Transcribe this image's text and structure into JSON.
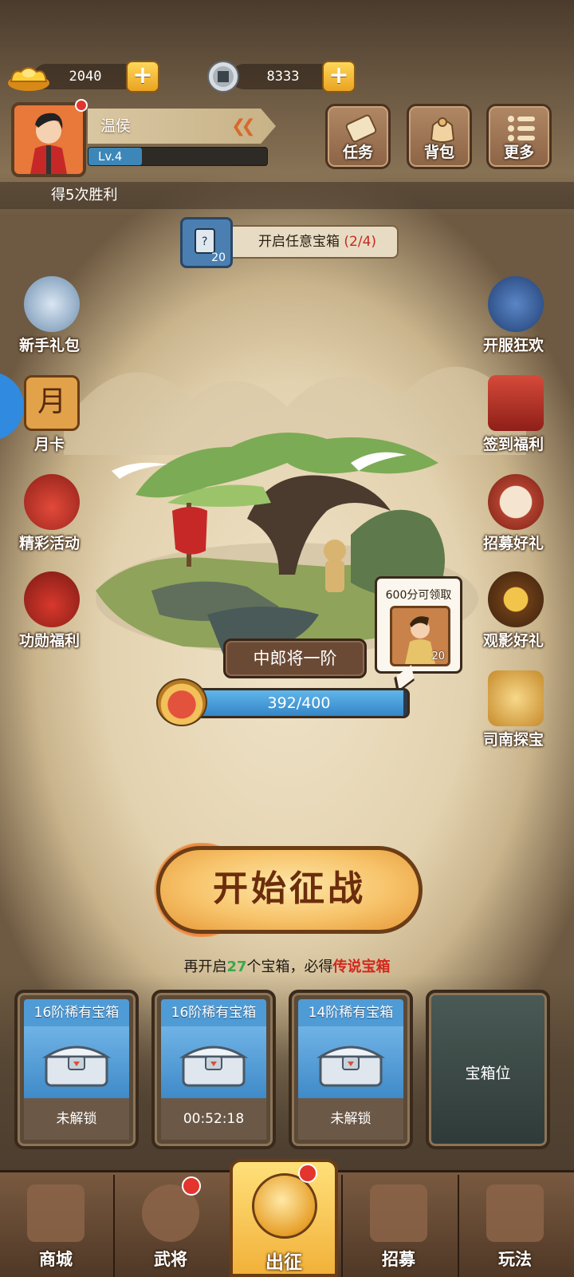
{
  "currency": {
    "gold": {
      "icon": "gold-ingot-icon",
      "value": "2040"
    },
    "silver": {
      "icon": "coin-icon",
      "value": "8333"
    }
  },
  "player": {
    "name": "温侯",
    "level": "Lv.4"
  },
  "top_buttons": [
    {
      "id": "task",
      "label": "任务",
      "icon": "scroll-icon"
    },
    {
      "id": "bag",
      "label": "背包",
      "icon": "bag-icon"
    },
    {
      "id": "more",
      "label": "更多",
      "icon": "menu-icon"
    }
  ],
  "quest_strip": "得5次胜利",
  "chest_task": {
    "text": "开启任意宝箱",
    "progress": "(2/4)",
    "reward_count": "20"
  },
  "left_side": [
    {
      "label": "新手礼包",
      "icon": "warrior-icon"
    },
    {
      "label": "月卡",
      "icon": "month-card-icon",
      "glyph": "月"
    },
    {
      "label": "精彩活动",
      "icon": "gift-bag-icon"
    },
    {
      "label": "功勋福利",
      "icon": "treasure-bag-icon"
    }
  ],
  "right_side": [
    {
      "label": "开服狂欢",
      "icon": "official-icon"
    },
    {
      "label": "签到福利",
      "icon": "seal-icon"
    },
    {
      "label": "招募好礼",
      "icon": "drum-icon"
    },
    {
      "label": "观影好礼",
      "icon": "video-reward-icon"
    },
    {
      "label": "司南探宝",
      "icon": "compass-icon"
    }
  ],
  "stage": {
    "rank": "中郎将一阶",
    "exp_text": "392/400",
    "exp_progress": 0.98,
    "reward_hint": "600分可领取",
    "reward_count": "20"
  },
  "start_button": "开始征战",
  "chest_hint": {
    "prefix": "再开启",
    "count": "27",
    "middle": "个宝箱，必得",
    "highlight": "传说宝箱"
  },
  "chest_slots": [
    {
      "title": "16阶稀有宝箱",
      "status": "未解锁"
    },
    {
      "title": "16阶稀有宝箱",
      "status": "00:52:18"
    },
    {
      "title": "14阶稀有宝箱",
      "status": "未解锁"
    }
  ],
  "empty_slot": "宝箱位",
  "nav": {
    "shop": "商城",
    "heroes": "武将",
    "battle": "出征",
    "recruit": "招募",
    "play": "玩法"
  }
}
